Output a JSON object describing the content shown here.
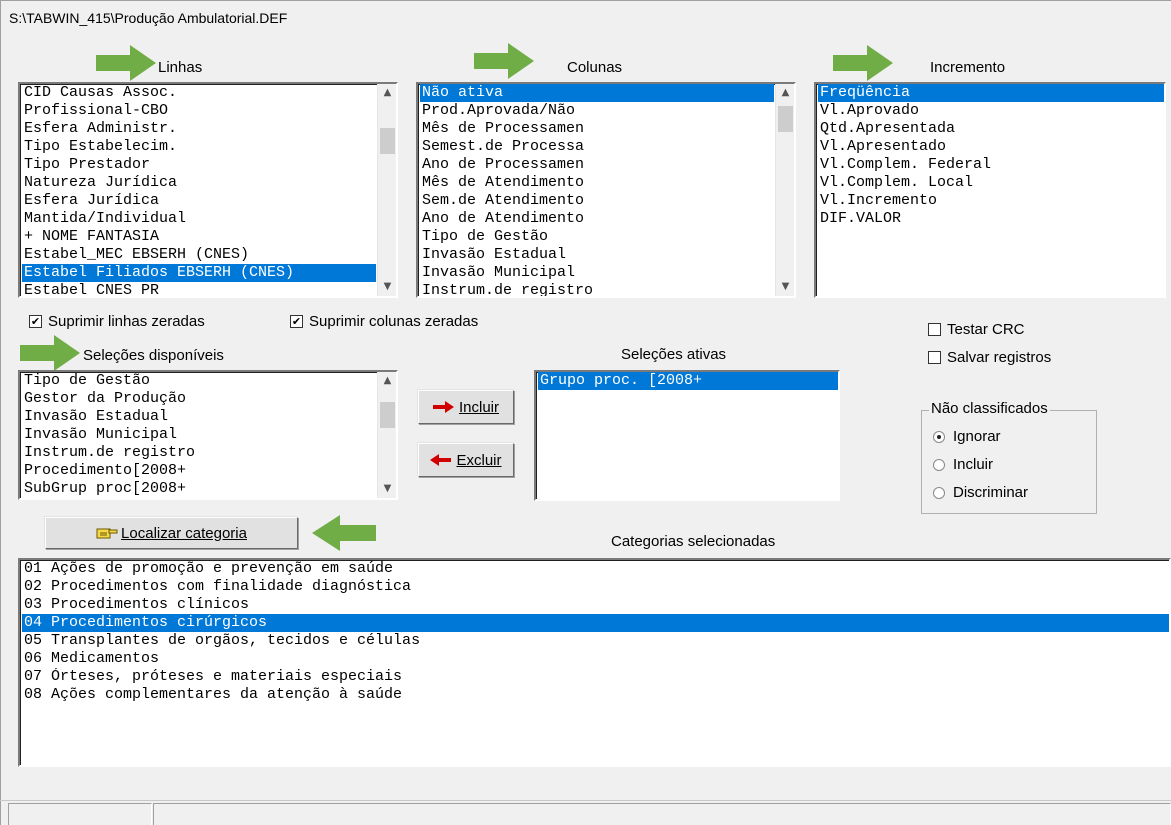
{
  "window": {
    "title": "S:\\TABWIN_415\\Produção Ambulatorial.DEF"
  },
  "linhas": {
    "label": "Linhas",
    "items": [
      {
        "text": "CID Causas Assoc.",
        "selected": false
      },
      {
        "text": "Profissional-CBO",
        "selected": false
      },
      {
        "text": "Esfera Administr.",
        "selected": false
      },
      {
        "text": "Tipo Estabelecim.",
        "selected": false
      },
      {
        "text": "Tipo Prestador",
        "selected": false
      },
      {
        "text": "Natureza Jurídica",
        "selected": false
      },
      {
        "text": "Esfera Jurídica",
        "selected": false
      },
      {
        "text": "Mantida/Individual",
        "selected": false
      },
      {
        "text": "+ NOME FANTASIA",
        "selected": false
      },
      {
        "text": "Estabel_MEC EBSERH (CNES)",
        "selected": false
      },
      {
        "text": "Estabel Filiados EBSERH (CNES)",
        "selected": true
      },
      {
        "text": "Estabel CNES PR",
        "selected": false
      }
    ]
  },
  "colunas": {
    "label": "Colunas",
    "items": [
      {
        "text": "Não ativa",
        "selected": true
      },
      {
        "text": "Prod.Aprovada/Não",
        "selected": false
      },
      {
        "text": "Mês de Processamen",
        "selected": false
      },
      {
        "text": "Semest.de Processa",
        "selected": false
      },
      {
        "text": "Ano de Processamen",
        "selected": false
      },
      {
        "text": "Mês de Atendimento",
        "selected": false
      },
      {
        "text": "Sem.de Atendimento",
        "selected": false
      },
      {
        "text": "Ano de Atendimento",
        "selected": false
      },
      {
        "text": "Tipo de Gestão",
        "selected": false
      },
      {
        "text": "Invasão Estadual",
        "selected": false
      },
      {
        "text": "Invasão Municipal",
        "selected": false
      },
      {
        "text": "Instrum.de registro",
        "selected": false
      }
    ]
  },
  "incremento": {
    "label": "Incremento",
    "items": [
      {
        "text": "Freqüência",
        "selected": true
      },
      {
        "text": "Vl.Aprovado",
        "selected": false
      },
      {
        "text": "Qtd.Apresentada",
        "selected": false
      },
      {
        "text": "Vl.Apresentado",
        "selected": false
      },
      {
        "text": "Vl.Complem. Federal",
        "selected": false
      },
      {
        "text": "Vl.Complem. Local",
        "selected": false
      },
      {
        "text": "Vl.Incremento",
        "selected": false
      },
      {
        "text": "DIF.VALOR",
        "selected": false
      }
    ]
  },
  "options": {
    "suprimir_linhas": {
      "label": "Suprimir linhas zeradas",
      "checked": true
    },
    "suprimir_colunas": {
      "label": "Suprimir colunas zeradas",
      "checked": true
    },
    "testar_crc": {
      "label": "Testar CRC",
      "checked": false
    },
    "salvar_registros": {
      "label": "Salvar registros",
      "checked": false
    }
  },
  "selecoes_disponiveis": {
    "label": "Seleções disponíveis",
    "items": [
      {
        "text": "Tipo de Gestão",
        "selected": false
      },
      {
        "text": "Gestor da Produção",
        "selected": false
      },
      {
        "text": "Invasão Estadual",
        "selected": false
      },
      {
        "text": "Invasão Municipal",
        "selected": false
      },
      {
        "text": "Instrum.de registro",
        "selected": false
      },
      {
        "text": "Procedimento[2008+",
        "selected": false
      },
      {
        "text": "SubGrup proc[2008+",
        "selected": false
      }
    ]
  },
  "selecoes_ativas": {
    "label": "Seleções ativas",
    "items": [
      {
        "text": "Grupo proc. [2008+",
        "selected": true
      }
    ]
  },
  "buttons": {
    "incluir": "Incluir",
    "excluir": "Excluir",
    "localizar": "Localizar categoria"
  },
  "nao_classificados": {
    "label": "Não classificados",
    "options": [
      {
        "label": "Ignorar",
        "checked": true
      },
      {
        "label": "Incluir",
        "checked": false
      },
      {
        "label": "Discriminar",
        "checked": false
      }
    ]
  },
  "categorias": {
    "label": "Categorias selecionadas",
    "items": [
      {
        "text": "01 Ações de promoção e prevenção em saúde",
        "selected": false
      },
      {
        "text": "02 Procedimentos com finalidade diagnóstica",
        "selected": false
      },
      {
        "text": "03 Procedimentos clínicos",
        "selected": false
      },
      {
        "text": "04 Procedimentos cirúrgicos",
        "selected": true
      },
      {
        "text": "05 Transplantes de orgãos, tecidos e células",
        "selected": false
      },
      {
        "text": "06 Medicamentos",
        "selected": false
      },
      {
        "text": "07 Órteses, próteses e materiais especiais",
        "selected": false
      },
      {
        "text": "08 Ações complementares da atenção à saúde",
        "selected": false
      }
    ]
  },
  "colors": {
    "selection": "#0078d7",
    "arrow": "#70ad47",
    "background": "#f0f0f0"
  }
}
